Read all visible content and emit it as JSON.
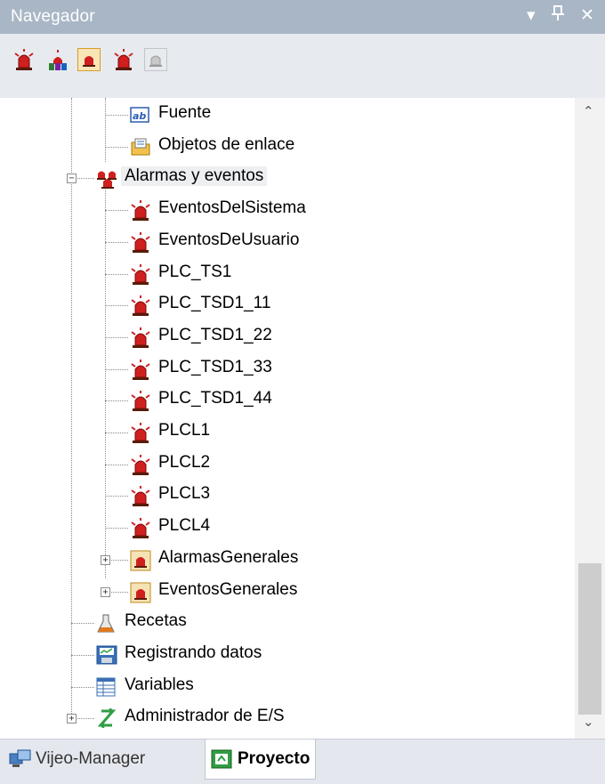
{
  "panel": {
    "title": "Navegador",
    "controls": {
      "dropdown": "▾",
      "pin": "ᵖ",
      "close": "✕"
    }
  },
  "toolbar": {
    "buttons": [
      {
        "icon": "alarm-beacon-icon",
        "selected": false
      },
      {
        "icon": "alarm-colors-icon",
        "selected": false
      },
      {
        "icon": "alarm-group-icon",
        "selected": true
      },
      {
        "icon": "alarm-beacon-icon",
        "selected": false
      },
      {
        "icon": "alarm-group-disabled-icon",
        "selected": false
      }
    ]
  },
  "tree": {
    "items": [
      {
        "label": "Fuente",
        "icon": "text-field-icon",
        "level": 3,
        "expander": ""
      },
      {
        "label": "Objetos de enlace",
        "icon": "link-objects-icon",
        "level": 3,
        "expander": ""
      },
      {
        "label": "Alarmas y eventos",
        "icon": "alarms-events-icon",
        "level": 2,
        "expander": "−",
        "highlighted": true
      },
      {
        "label": "EventosDelSistema",
        "icon": "alarm-beacon-icon",
        "level": 3,
        "expander": ""
      },
      {
        "label": "EventosDeUsuario",
        "icon": "alarm-beacon-icon",
        "level": 3,
        "expander": ""
      },
      {
        "label": "PLC_TS1",
        "icon": "alarm-beacon-icon",
        "level": 3,
        "expander": ""
      },
      {
        "label": "PLC_TSD1_11",
        "icon": "alarm-beacon-icon",
        "level": 3,
        "expander": ""
      },
      {
        "label": "PLC_TSD1_22",
        "icon": "alarm-beacon-icon",
        "level": 3,
        "expander": ""
      },
      {
        "label": "PLC_TSD1_33",
        "icon": "alarm-beacon-icon",
        "level": 3,
        "expander": ""
      },
      {
        "label": "PLC_TSD1_44",
        "icon": "alarm-beacon-icon",
        "level": 3,
        "expander": ""
      },
      {
        "label": "PLCL1",
        "icon": "alarm-beacon-icon",
        "level": 3,
        "expander": ""
      },
      {
        "label": "PLCL2",
        "icon": "alarm-beacon-icon",
        "level": 3,
        "expander": ""
      },
      {
        "label": "PLCL3",
        "icon": "alarm-beacon-icon",
        "level": 3,
        "expander": ""
      },
      {
        "label": "PLCL4",
        "icon": "alarm-beacon-icon",
        "level": 3,
        "expander": ""
      },
      {
        "label": "AlarmasGenerales",
        "icon": "alarm-group-icon",
        "level": 3,
        "expander": "+"
      },
      {
        "label": "EventosGenerales",
        "icon": "alarm-group-icon",
        "level": 3,
        "expander": "+"
      },
      {
        "label": "Recetas",
        "icon": "flask-icon",
        "level": 2,
        "expander": ""
      },
      {
        "label": "Registrando datos",
        "icon": "data-logging-icon",
        "level": 2,
        "expander": ""
      },
      {
        "label": "Variables",
        "icon": "variables-table-icon",
        "level": 2,
        "expander": ""
      },
      {
        "label": "Administrador de E/S",
        "icon": "io-manager-icon",
        "level": 2,
        "expander": "+"
      }
    ]
  },
  "scrollbar": {
    "up": "⌃",
    "down": "⌄"
  },
  "tabs": [
    {
      "label": "Vijeo-Manager",
      "icon": "vijeo-manager-icon",
      "active": false
    },
    {
      "label": "Proyecto",
      "icon": "project-icon",
      "active": true
    }
  ],
  "colors": {
    "titlebar": "#a9b6c6",
    "toolbar": "#e7ebf0",
    "alarm_red": "#d01f1f",
    "selection_border": "#d79b2c"
  }
}
